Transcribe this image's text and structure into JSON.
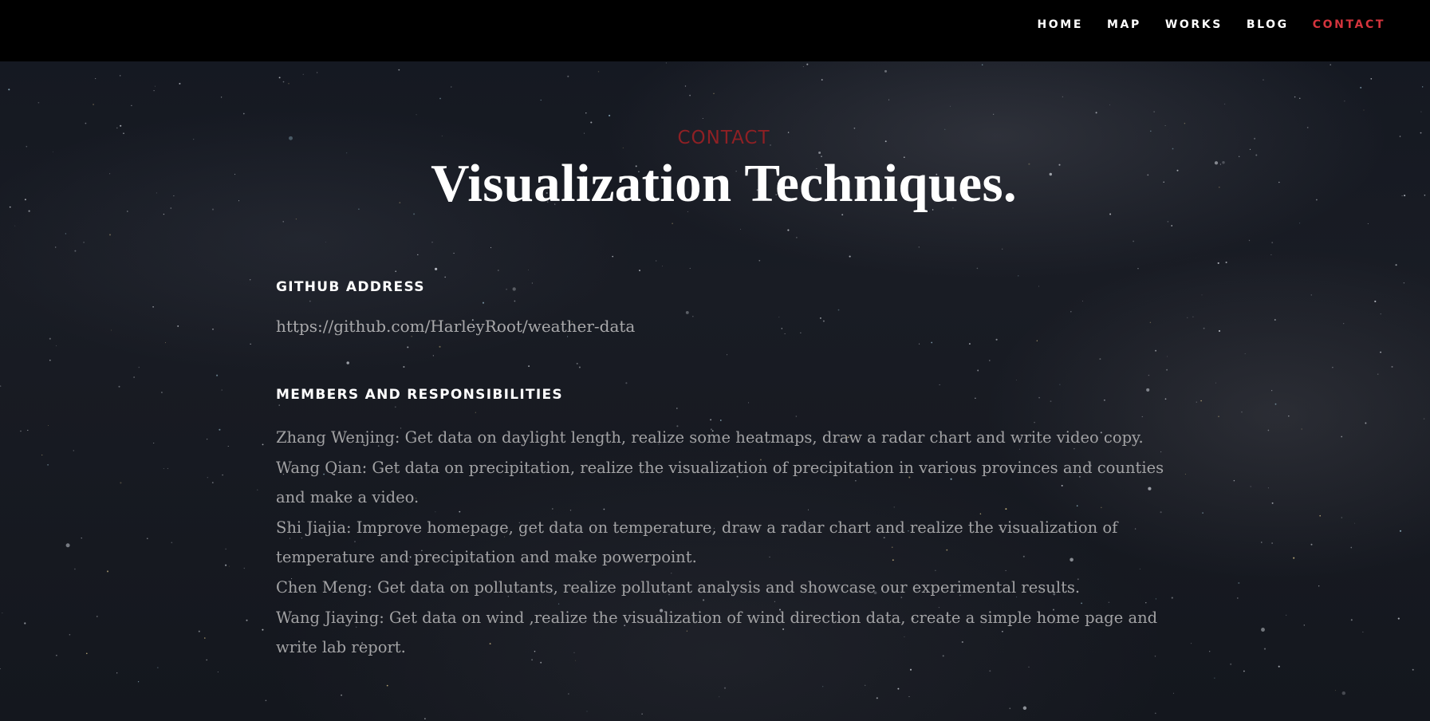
{
  "nav": {
    "items": [
      {
        "label": "HOME"
      },
      {
        "label": "MAP"
      },
      {
        "label": "WORKS"
      },
      {
        "label": "BLOG"
      },
      {
        "label": "CONTACT",
        "active": true
      }
    ]
  },
  "header": {
    "kicker": "CONTACT",
    "title": "Visualization Techniques."
  },
  "github": {
    "heading": "GITHUB ADDRESS",
    "url": "https://github.com/HarleyRoot/weather-data"
  },
  "members": {
    "heading": "MEMBERS AND RESPONSIBILITIES",
    "items": [
      "Zhang Wenjing: Get data on daylight length, realize some heatmaps, draw a radar chart and write video copy.",
      "Wang Qian: Get data on precipitation, realize the visualization of precipitation in various provinces and counties and make a video.",
      "Shi Jiajia: Improve homepage, get data on temperature, draw a radar chart and realize the visualization of temperature and precipitation and make powerpoint.",
      "Chen Meng: Get data on pollutants, realize pollutant analysis and showcase our experimental results.",
      "Wang Jiaying: Get data on wind ,realize the visualization of wind direction data, create a simple home page and write lab report."
    ]
  },
  "colors": {
    "accent": "#d4343d",
    "kicker": "#8e2024",
    "navbar_bg": "#000000",
    "text_muted": "#a2a2a4",
    "heading": "#ffffff"
  }
}
